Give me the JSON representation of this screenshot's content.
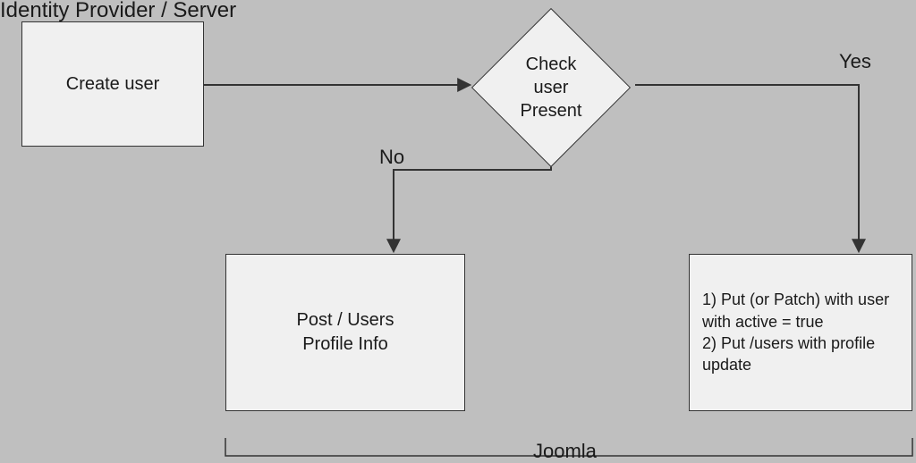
{
  "labels": {
    "title": "Identity Provider / Server",
    "footer": "Joomla",
    "no": "No",
    "yes": "Yes"
  },
  "boxes": {
    "create_user": "Create user",
    "check_user": "Check\nuser\nPresent",
    "post_users": "Post / Users\nProfile Info",
    "put_patch": "1) Put (or Patch) with user with active = true\n2) Put /users with profile update"
  }
}
